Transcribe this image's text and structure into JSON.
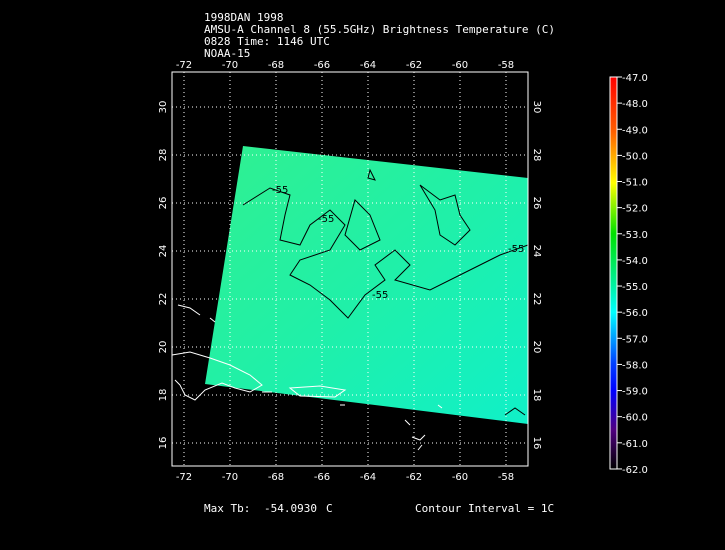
{
  "header": {
    "line1": "1998DAN 1998",
    "line2": "AMSU-A Channel 8 (55.5GHz) Brightness Temperature (C)",
    "line3": "0828 Time: 1146 UTC",
    "line4": "NOAA-15"
  },
  "map": {
    "lon_ticks": [
      "-72",
      "-70",
      "-68",
      "-66",
      "-64",
      "-62",
      "-60",
      "-58"
    ],
    "lat_ticks": [
      "30",
      "28",
      "26",
      "24",
      "22",
      "20",
      "18",
      "16"
    ],
    "contour_labels": [
      "-55",
      "-55",
      "-55",
      "-55"
    ],
    "swath_color": "#22f0a0"
  },
  "colorbar": {
    "labels": [
      "-47.0",
      "-48.0",
      "-49.0",
      "-50.0",
      "-51.0",
      "-52.0",
      "-53.0",
      "-54.0",
      "-55.0",
      "-56.0",
      "-57.0",
      "-58.0",
      "-59.0",
      "-60.0",
      "-61.0",
      "-62.0"
    ]
  },
  "footer": {
    "max_label": "Max Tb:",
    "max_value": "-54.0930",
    "max_unit": "C",
    "contour_interval": "Contour Interval = 1C"
  }
}
